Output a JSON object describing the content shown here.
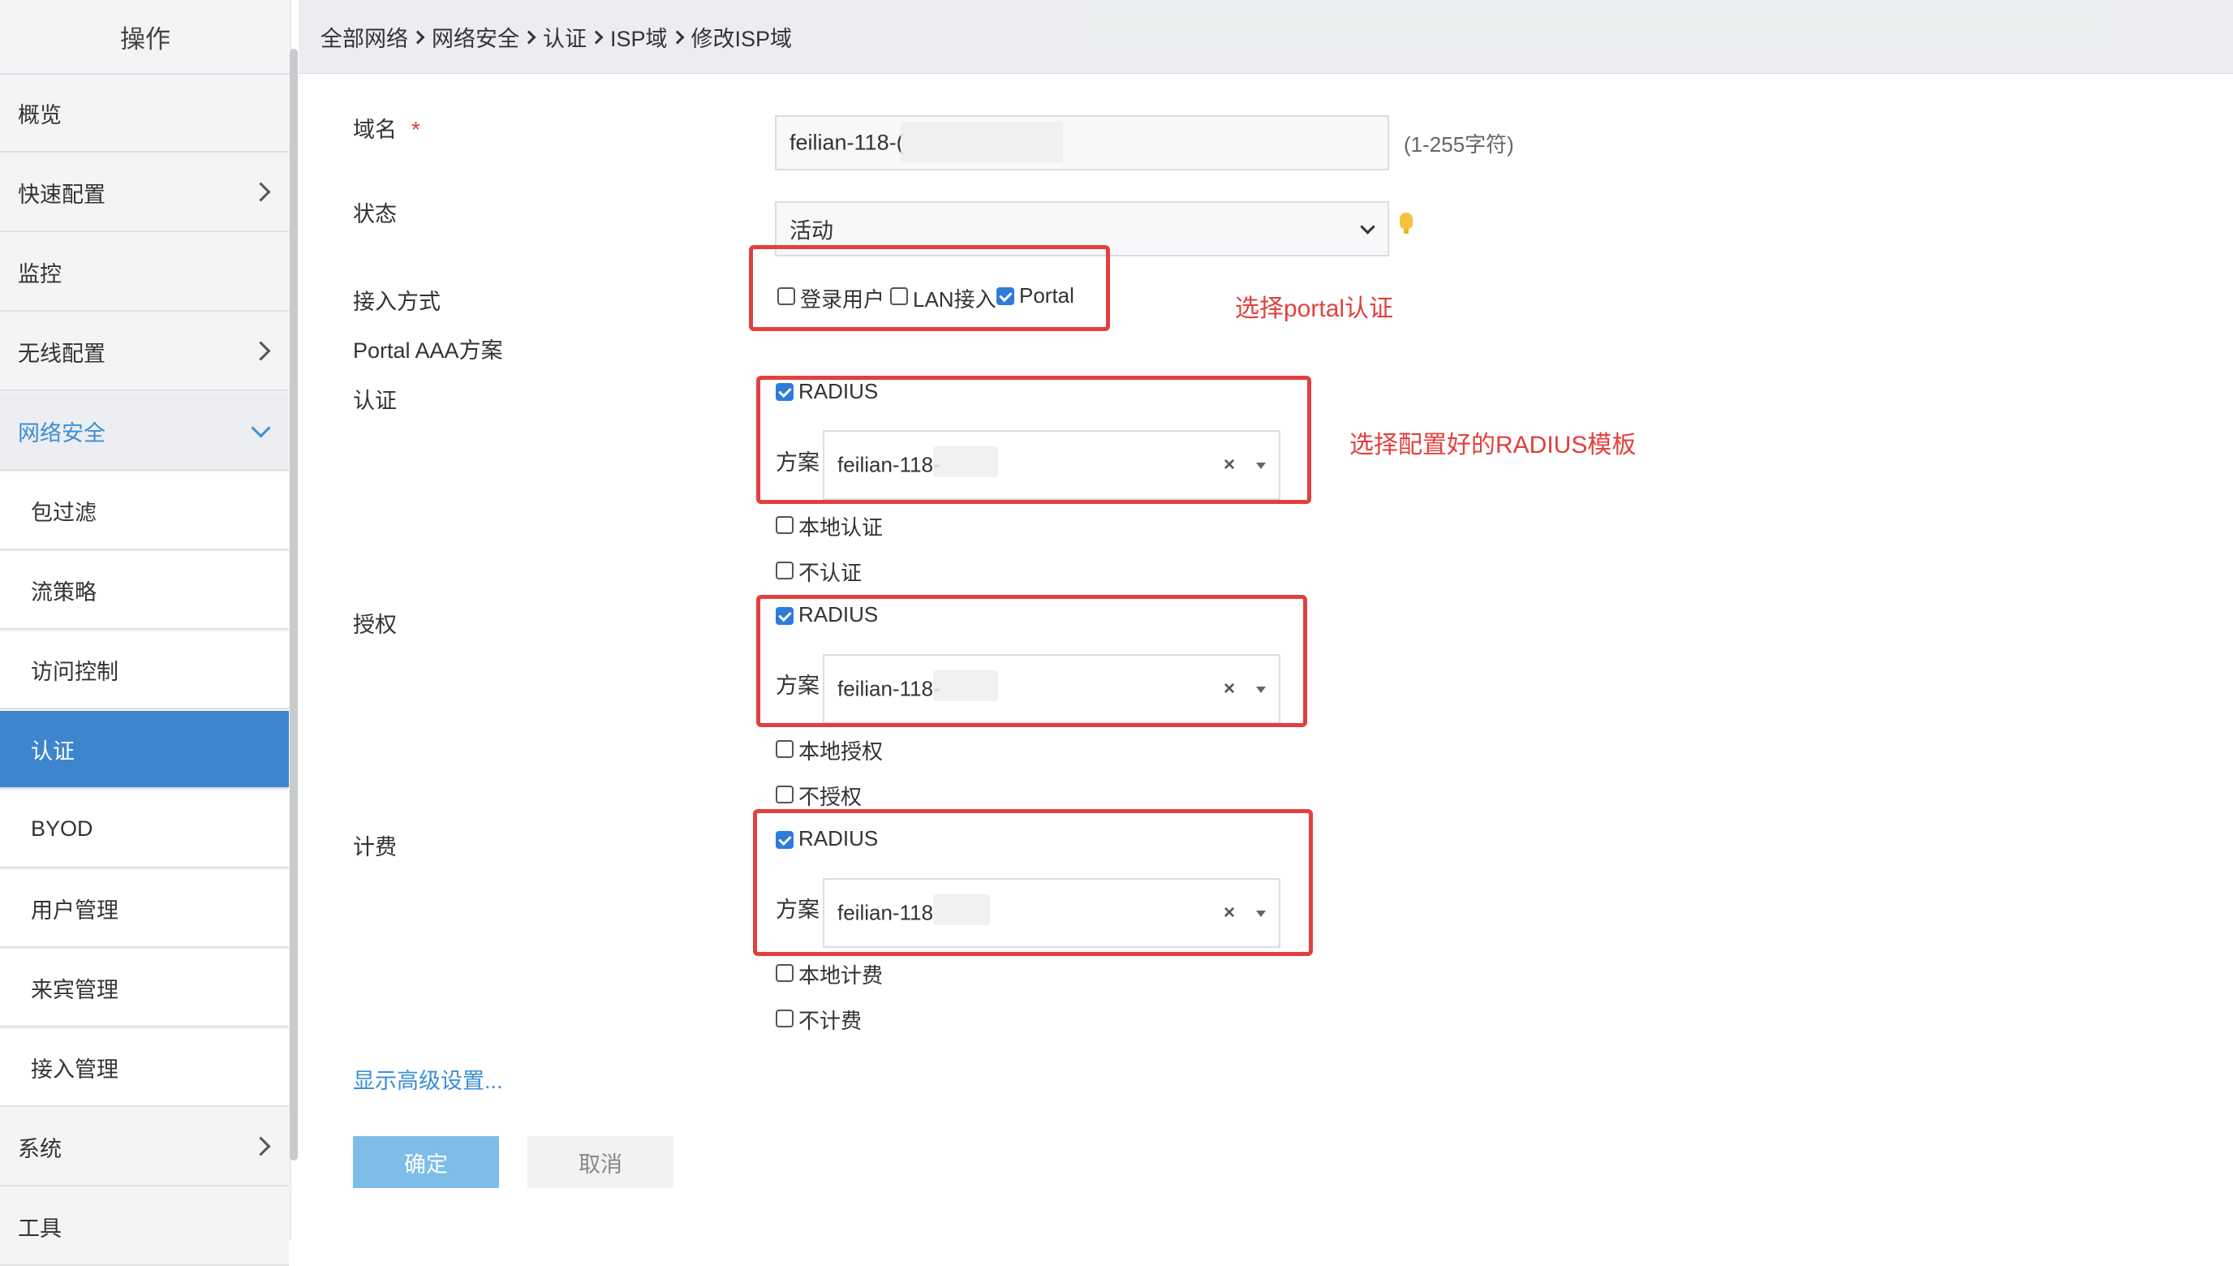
{
  "sidebar": {
    "header": "操作",
    "items": [
      {
        "label": "概览",
        "type": "top",
        "arrow": "none"
      },
      {
        "label": "快速配置",
        "type": "top",
        "arrow": "right"
      },
      {
        "label": "监控",
        "type": "top",
        "arrow": "none"
      },
      {
        "label": "无线配置",
        "type": "top",
        "arrow": "right"
      },
      {
        "label": "网络安全",
        "type": "expanded",
        "arrow": "down"
      },
      {
        "label": "包过滤",
        "type": "sub"
      },
      {
        "label": "流策略",
        "type": "sub"
      },
      {
        "label": "访问控制",
        "type": "sub"
      },
      {
        "label": "认证",
        "type": "active"
      },
      {
        "label": "BYOD",
        "type": "sub"
      },
      {
        "label": "用户管理",
        "type": "sub"
      },
      {
        "label": "来宾管理",
        "type": "sub"
      },
      {
        "label": "接入管理",
        "type": "sub"
      },
      {
        "label": "系统",
        "type": "top",
        "arrow": "right"
      },
      {
        "label": "工具",
        "type": "top",
        "arrow": "none"
      }
    ]
  },
  "breadcrumb": [
    "全部网络",
    "网络安全",
    "认证",
    "ISP域",
    "修改ISP域"
  ],
  "form": {
    "domain_name": {
      "label": "域名",
      "required_mark": "*",
      "value": "feilian-118-(",
      "hint": "(1-255字符)"
    },
    "status": {
      "label": "状态",
      "value": "活动"
    },
    "access_method": {
      "label": "接入方式",
      "options": [
        {
          "label": "登录用户",
          "checked": false
        },
        {
          "label": "LAN接入",
          "checked": false
        },
        {
          "label": "Portal",
          "checked": true
        }
      ]
    },
    "portal_aaa_label": "Portal AAA方案",
    "authentication": {
      "label": "认证",
      "radius": {
        "label": "RADIUS",
        "checked": true
      },
      "scheme_label": "方案",
      "scheme_value": "feilian-118-",
      "other_options": [
        {
          "label": "本地认证",
          "checked": false
        },
        {
          "label": "不认证",
          "checked": false
        }
      ]
    },
    "authorization": {
      "label": "授权",
      "radius": {
        "label": "RADIUS",
        "checked": true
      },
      "scheme_label": "方案",
      "scheme_value": "feilian-118-",
      "other_options": [
        {
          "label": "本地授权",
          "checked": false
        },
        {
          "label": "不授权",
          "checked": false
        }
      ]
    },
    "accounting": {
      "label": "计费",
      "radius": {
        "label": "RADIUS",
        "checked": true
      },
      "scheme_label": "方案",
      "scheme_value": "feilian-118",
      "other_options": [
        {
          "label": "本地计费",
          "checked": false
        },
        {
          "label": "不计费",
          "checked": false
        }
      ]
    },
    "clear_symbol": "×",
    "advanced_link": "显示高级设置...",
    "confirm_label": "确定",
    "cancel_label": "取消"
  },
  "annotations": {
    "portal_note": "选择portal认证",
    "radius_note": "选择配置好的RADIUS模板"
  },
  "colors": {
    "accent": "#3d85cc",
    "annotation": "#e0413e",
    "checkbox_checked": "#2f7bd8",
    "confirm_button": "#7dbde8"
  }
}
